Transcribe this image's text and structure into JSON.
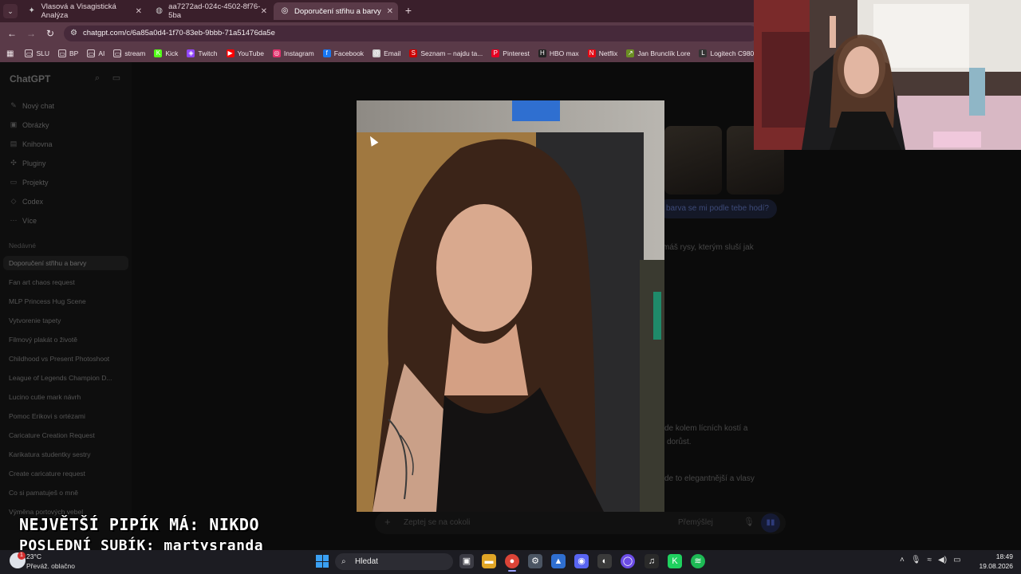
{
  "browser": {
    "tabs": [
      {
        "label": "Vlasová a Visagistická Analýza"
      },
      {
        "label": "aa7272ad-024c-4502-8f76-5ba"
      },
      {
        "label": "Doporučení střihu a barvy"
      }
    ],
    "url": "chatgpt.com/c/6a85a0d4-1f70-83eb-9bbb-71a51476da5e",
    "bookmarks": [
      {
        "label": "SLU",
        "icon": "folder-icon"
      },
      {
        "label": "BP",
        "icon": "folder-icon"
      },
      {
        "label": "AI",
        "icon": "folder-icon"
      },
      {
        "label": "stream",
        "icon": "folder-icon"
      },
      {
        "label": "Kick",
        "icon": "kick-icon",
        "color": "#53fc18"
      },
      {
        "label": "Twitch",
        "icon": "twitch-icon",
        "color": "#9146ff"
      },
      {
        "label": "YouTube",
        "icon": "youtube-icon",
        "color": "#ff0000"
      },
      {
        "label": "Instagram",
        "icon": "instagram-icon",
        "color": "#e1306c"
      },
      {
        "label": "Facebook",
        "icon": "facebook-icon",
        "color": "#1877f2"
      },
      {
        "label": "Email",
        "icon": "email-icon",
        "color": "#cccccc"
      },
      {
        "label": "Seznam – najdu ta...",
        "icon": "seznam-icon",
        "color": "#cc0000"
      },
      {
        "label": "Pinterest",
        "icon": "pinterest-icon",
        "color": "#e60023"
      },
      {
        "label": "HBO max",
        "icon": "hbo-icon",
        "color": "#222222"
      },
      {
        "label": "Netflix",
        "icon": "netflix-icon",
        "color": "#e50914"
      },
      {
        "label": "Jan Brunclík Lore",
        "icon": "link-icon",
        "color": "#6b8e23"
      },
      {
        "label": "Logitech C980 Stre",
        "icon": "logitech-icon",
        "color": "#333333"
      }
    ]
  },
  "sidebar": {
    "brand": "ChatGPT",
    "nav": [
      {
        "label": "Nový chat",
        "icon": "new-chat-icon"
      },
      {
        "label": "Obrázky",
        "icon": "images-icon"
      },
      {
        "label": "Knihovna",
        "icon": "library-icon"
      },
      {
        "label": "Pluginy",
        "icon": "plugins-icon"
      },
      {
        "label": "Projekty",
        "icon": "projects-icon"
      },
      {
        "label": "Codex",
        "icon": "codex-icon"
      },
      {
        "label": "Více",
        "icon": "more-icon"
      }
    ],
    "recent_heading": "Nedávné",
    "recent": [
      "Doporučení střihu a barvy",
      "Fan art chaos request",
      "MLP Princess Hug Scene",
      "Vytvorenie tapety",
      "Filmový plakát o životě",
      "Childhood vs Present Photoshoot",
      "League of Legends Champion D...",
      "Lucino cutie mark návrh",
      "Pomoc Erikovi s ortézami",
      "Caricature Creation Request",
      "Karikatura studentky sestry",
      "Create caricature request",
      "Co si pamatuješ o mně",
      "Výměna portových vebel"
    ]
  },
  "chat": {
    "user_message": "barva se mi podle tebe hodí?",
    "fragments": [
      "máš rysy, kterým sluší jak",
      "de kolem lícních kostí a",
      "dorůst.",
      "de to elegantnější a vlasy"
    ],
    "composer_placeholder": "Zeptej se na cokoli",
    "think_label": "Přemýšlej"
  },
  "overlay": {
    "line1": "NEJVĚTŠÍ PIPÍK MÁ: NIKDO",
    "line2": "POSLEDNÍ SUBÍK: martysranda"
  },
  "taskbar": {
    "temperature": "23°C",
    "weather": "Převáž. oblačno",
    "search_label": "Hledat",
    "time": "18:49",
    "date": "19.08.2026"
  }
}
